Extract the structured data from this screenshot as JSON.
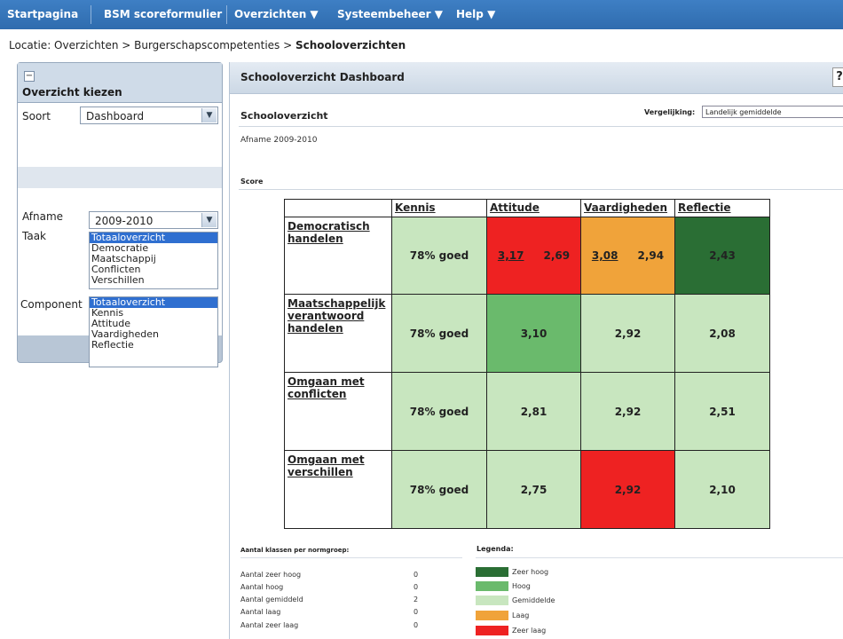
{
  "nav": {
    "items": [
      "Startpagina",
      "BSM scoreformulier",
      "Overzichten ▼",
      "Systeembeheer ▼",
      "Help ▼"
    ]
  },
  "breadcrumb": {
    "prefix": "Locatie: Overzichten > Burgerschapscompetenties > ",
    "current": "Schooloverzichten"
  },
  "left_panel": {
    "minimize": "−",
    "title": "Overzicht kiezen",
    "soort_label": "Soort",
    "soort_value": "Dashboard",
    "afname_label": "Afname",
    "afname_value": "2009-2010",
    "taak_label": "Taak",
    "taak_options": [
      "Totaaloverzicht",
      "Democratie",
      "Maatschappij",
      "Conflicten",
      "Verschillen"
    ],
    "component_label": "Component",
    "component_options": [
      "Totaaloverzicht",
      "Kennis",
      "Attitude",
      "Vaardigheden",
      "Reflectie"
    ]
  },
  "main": {
    "title": "Schooloverzicht Dashboard",
    "help": "?",
    "subtitle": "Schooloverzicht",
    "vergelijking_label": "Vergelijking:",
    "vergelijking_value": "Landelijk gemiddelde",
    "afname_text": "Afname 2009-2010",
    "score_label": "Score"
  },
  "table": {
    "columns": [
      "Kennis",
      "Attitude",
      "Vaardigheden",
      "Reflectie"
    ],
    "rows": [
      {
        "label": "Democratisch handelen",
        "cells": [
          {
            "a": "78% goed",
            "b": "",
            "color": "#c8e6bf",
            "text_color": "#222"
          },
          {
            "a": "3,17",
            "b": "2,69",
            "color": "#ee2222",
            "text_color": "#222",
            "underline_a": true
          },
          {
            "a": "3,08",
            "b": "2,94",
            "color": "#f0a33a",
            "text_color": "#222",
            "underline_a": true
          },
          {
            "a": "2,43",
            "b": "",
            "color": "#2a6e34",
            "text_color": "#222"
          }
        ]
      },
      {
        "label": "Maatschappelijk verantwoord handelen",
        "cells": [
          {
            "a": "78% goed",
            "b": "",
            "color": "#c8e6bf",
            "text_color": "#222"
          },
          {
            "a": "3,10",
            "b": "",
            "color": "#6aba6c",
            "text_color": "#222"
          },
          {
            "a": "2,92",
            "b": "",
            "color": "#c8e6bf",
            "text_color": "#222"
          },
          {
            "a": "2,08",
            "b": "",
            "color": "#c8e6bf",
            "text_color": "#222"
          }
        ]
      },
      {
        "label": "Omgaan met conflicten",
        "cells": [
          {
            "a": "78% goed",
            "b": "",
            "color": "#c8e6bf",
            "text_color": "#222"
          },
          {
            "a": "2,81",
            "b": "",
            "color": "#c8e6bf",
            "text_color": "#222"
          },
          {
            "a": "2,92",
            "b": "",
            "color": "#c8e6bf",
            "text_color": "#222"
          },
          {
            "a": "2,51",
            "b": "",
            "color": "#c8e6bf",
            "text_color": "#222"
          }
        ]
      },
      {
        "label": "Omgaan met verschillen",
        "cells": [
          {
            "a": "78% goed",
            "b": "",
            "color": "#c8e6bf",
            "text_color": "#222"
          },
          {
            "a": "2,75",
            "b": "",
            "color": "#c8e6bf",
            "text_color": "#222"
          },
          {
            "a": "2,92",
            "b": "",
            "color": "#ee2222",
            "text_color": "#222"
          },
          {
            "a": "2,10",
            "b": "",
            "color": "#c8e6bf",
            "text_color": "#222"
          }
        ]
      }
    ]
  },
  "counts": {
    "title": "Aantal klassen per normgroep:",
    "rows": [
      {
        "label": "Aantal zeer hoog",
        "value": "0"
      },
      {
        "label": "Aantal hoog",
        "value": "0"
      },
      {
        "label": "Aantal gemiddeld",
        "value": "2"
      },
      {
        "label": "Aantal laag",
        "value": "0"
      },
      {
        "label": "Aantal zeer laag",
        "value": "0"
      }
    ]
  },
  "legend": {
    "title": "Legenda:",
    "items": [
      {
        "label": "Zeer hoog",
        "color": "#2a6e34"
      },
      {
        "label": "Hoog",
        "color": "#6aba6c"
      },
      {
        "label": "Gemiddelde",
        "color": "#c8e6bf"
      },
      {
        "label": "Laag",
        "color": "#f0a33a"
      },
      {
        "label": "Zeer laag",
        "color": "#ee2222"
      }
    ]
  }
}
